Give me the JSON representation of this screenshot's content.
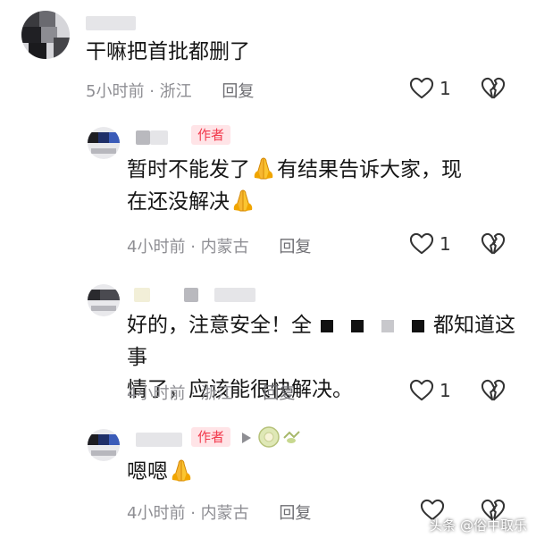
{
  "comments": [
    {
      "text": "干嘛把首批都删了",
      "time": "5小时前",
      "location": "浙江",
      "reply_label": "回复",
      "likes": "1"
    },
    {
      "author_badge": "作者",
      "text_line1": "暂时不能发了",
      "text_line1b": "有结果告诉大家，现",
      "text_line2": "在还没解决",
      "time": "4小时前",
      "location": "内蒙古",
      "reply_label": "回复",
      "likes": "1"
    },
    {
      "text_line1a": "好的，注意安全！全",
      "text_line1b": "都知道这事",
      "text_line2": "情了，应该能很快解决。",
      "time": "4小时前",
      "location": "浙江",
      "reply_label": "回复",
      "likes": "1"
    },
    {
      "author_badge": "作者",
      "text": "嗯嗯",
      "time": "4小时前",
      "location": "内蒙古",
      "reply_label": "回复"
    }
  ],
  "meta_separator": "·",
  "watermark": "头条 @俗中取乐",
  "colors": {
    "author_badge_text": "#f23a4d",
    "author_badge_bg": "#ffe4e7",
    "meta": "#8e8e93"
  }
}
